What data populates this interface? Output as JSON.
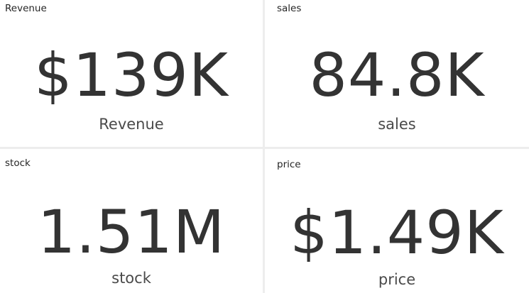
{
  "cards": [
    {
      "title": "Revenue",
      "value": "$139K",
      "label": "Revenue"
    },
    {
      "title": "sales",
      "value": "84.8K",
      "label": "sales"
    },
    {
      "title": "stock",
      "value": "1.51M",
      "label": "stock"
    },
    {
      "title": "price",
      "value": "$1.49K",
      "label": "price"
    }
  ]
}
